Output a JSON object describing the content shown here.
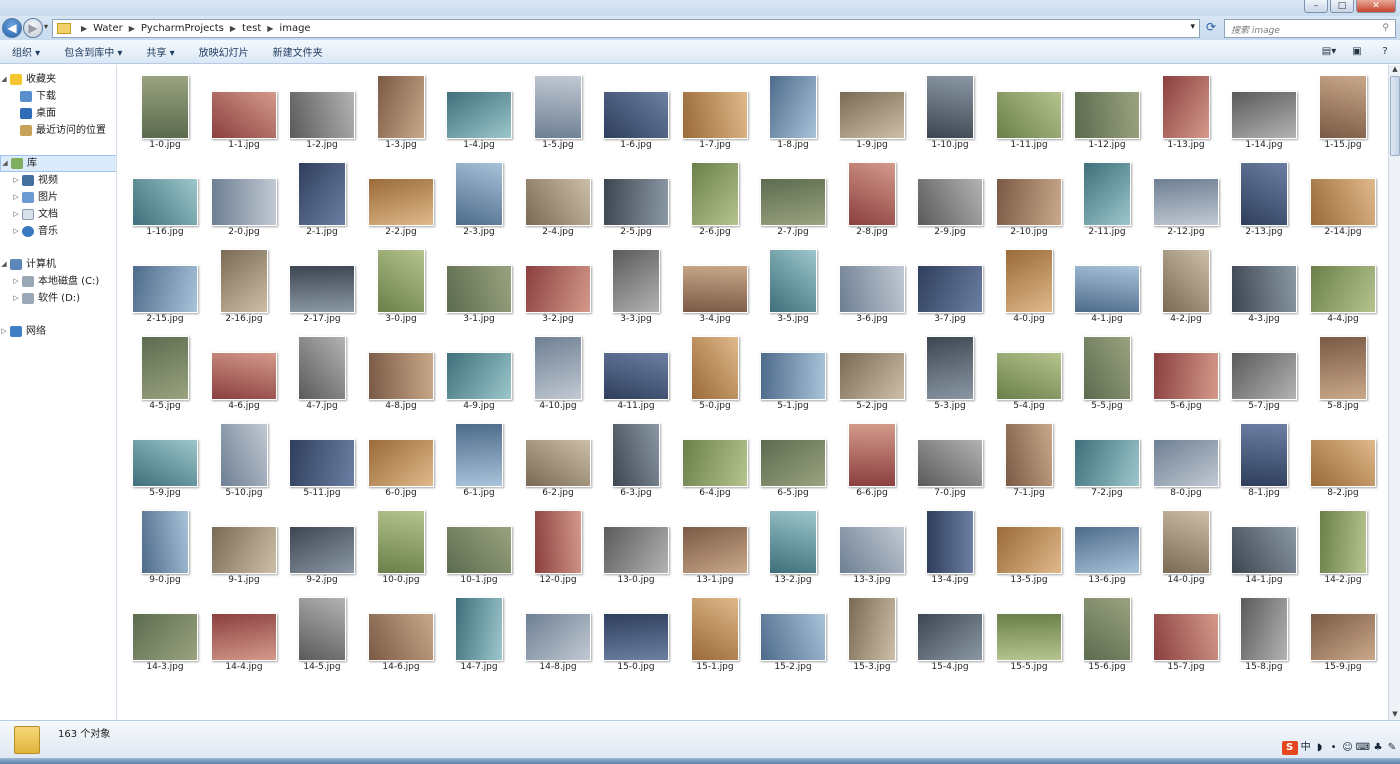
{
  "window": {
    "controls": [
      "–",
      "□",
      "✕"
    ]
  },
  "address": {
    "crumbs": [
      "Water",
      "PycharmProjects",
      "test",
      "image"
    ],
    "search_placeholder": "搜索 image"
  },
  "toolbar": {
    "organize": "组织 ▾",
    "include": "包含到库中 ▾",
    "share": "共享 ▾",
    "slideshow": "放映幻灯片",
    "newfolder": "新建文件夹"
  },
  "nav": {
    "favorites": "收藏夹",
    "downloads": "下载",
    "desktop": "桌面",
    "recent": "最近访问的位置",
    "libraries": "库",
    "videos": "视频",
    "pictures": "图片",
    "documents": "文档",
    "music": "音乐",
    "computer": "计算机",
    "drive_c": "本地磁盘 (C:)",
    "drive_d": "软件 (D:)",
    "network": "网络"
  },
  "status": {
    "count": "163 个对象"
  },
  "tray": {
    "ime": "中"
  },
  "files": [
    "1-0.jpg",
    "1-1.jpg",
    "1-2.jpg",
    "1-3.jpg",
    "1-4.jpg",
    "1-5.jpg",
    "1-6.jpg",
    "1-7.jpg",
    "1-8.jpg",
    "1-9.jpg",
    "1-10.jpg",
    "1-11.jpg",
    "1-12.jpg",
    "1-13.jpg",
    "1-14.jpg",
    "1-15.jpg",
    "1-16.jpg",
    "2-0.jpg",
    "2-1.jpg",
    "2-2.jpg",
    "2-3.jpg",
    "2-4.jpg",
    "2-5.jpg",
    "2-6.jpg",
    "2-7.jpg",
    "2-8.jpg",
    "2-9.jpg",
    "2-10.jpg",
    "2-11.jpg",
    "2-12.jpg",
    "2-13.jpg",
    "2-14.jpg",
    "2-15.jpg",
    "2-16.jpg",
    "2-17.jpg",
    "3-0.jpg",
    "3-1.jpg",
    "3-2.jpg",
    "3-3.jpg",
    "3-4.jpg",
    "3-5.jpg",
    "3-6.jpg",
    "3-7.jpg",
    "4-0.jpg",
    "4-1.jpg",
    "4-2.jpg",
    "4-3.jpg",
    "4-4.jpg",
    "4-5.jpg",
    "4-6.jpg",
    "4-7.jpg",
    "4-8.jpg",
    "4-9.jpg",
    "4-10.jpg",
    "4-11.jpg",
    "5-0.jpg",
    "5-1.jpg",
    "5-2.jpg",
    "5-3.jpg",
    "5-4.jpg",
    "5-5.jpg",
    "5-6.jpg",
    "5-7.jpg",
    "5-8.jpg",
    "5-9.jpg",
    "5-10.jpg",
    "5-11.jpg",
    "6-0.jpg",
    "6-1.jpg",
    "6-2.jpg",
    "6-3.jpg",
    "6-4.jpg",
    "6-5.jpg",
    "6-6.jpg",
    "7-0.jpg",
    "7-1.jpg",
    "7-2.jpg",
    "8-0.jpg",
    "8-1.jpg",
    "8-2.jpg",
    "9-0.jpg",
    "9-1.jpg",
    "9-2.jpg",
    "10-0.jpg",
    "10-1.jpg",
    "12-0.jpg",
    "13-0.jpg",
    "13-1.jpg",
    "13-2.jpg",
    "13-3.jpg",
    "13-4.jpg",
    "13-5.jpg",
    "13-6.jpg",
    "14-0.jpg",
    "14-1.jpg",
    "14-2.jpg",
    "14-3.jpg",
    "14-4.jpg",
    "14-5.jpg",
    "14-6.jpg",
    "14-7.jpg",
    "14-8.jpg",
    "15-0.jpg",
    "15-1.jpg",
    "15-2.jpg",
    "15-3.jpg",
    "15-4.jpg",
    "15-5.jpg",
    "15-6.jpg",
    "15-7.jpg",
    "15-8.jpg",
    "15-9.jpg"
  ]
}
